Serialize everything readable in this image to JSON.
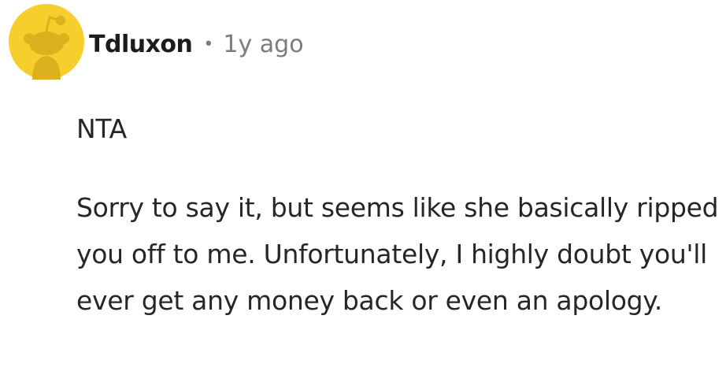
{
  "comment": {
    "author": "Tdluxon",
    "separator": "•",
    "timestamp": "1y ago",
    "avatar": {
      "icon": "snoo-avatar-icon",
      "bg_color": "#f6cf2c",
      "figure_color": "#dbb21d"
    },
    "paragraphs": [
      "NTA",
      "Sorry to say it, but seems like she basically ripped you off to me. Unfortunately, I highly doubt you'll ever get any money back or even an apology."
    ]
  }
}
